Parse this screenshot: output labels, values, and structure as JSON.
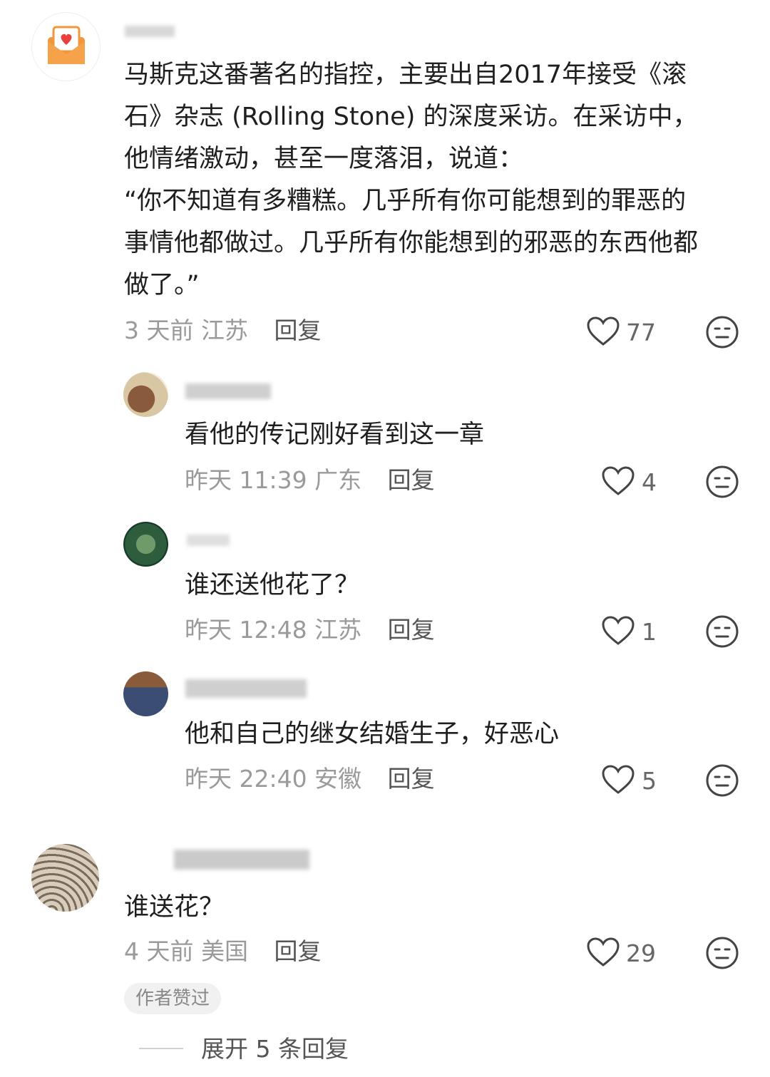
{
  "comments": [
    {
      "text_lines": [
        "马斯克这番著名的指控，主要出自2017年接受《滚",
        "石》杂志 (Rolling Stone) 的深度采访。在采访中，",
        "他情绪激动，甚至一度落泪，说道：",
        "“你不知道有多糟糕。几乎所有你可能想到的罪恶的",
        "事情他都做过。几乎所有你能想到的邪恶的东西他都",
        "做了。”"
      ],
      "meta": "3 天前 江苏",
      "reply_label": "回复",
      "likes": "77"
    },
    {
      "text_lines": [
        "谁送花？"
      ],
      "meta": "4 天前 美国",
      "reply_label": "回复",
      "likes": "29",
      "badge": "作者赞过"
    }
  ],
  "replies": [
    {
      "text": "看他的传记刚好看到这一章",
      "meta": "昨天 11:39 广东",
      "reply_label": "回复",
      "likes": "4"
    },
    {
      "text": "谁还送他花了？",
      "meta": "昨天 12:48 江苏",
      "reply_label": "回复",
      "likes": "1"
    },
    {
      "text": "他和自己的继女结婚生子，好恶心",
      "meta": "昨天 22:40 安徽",
      "reply_label": "回复",
      "likes": "5"
    }
  ],
  "expand_label": "展开 5 条回复",
  "icons": {
    "like": "heart-outline-icon",
    "dislike": "neutral-face-icon"
  },
  "colors": {
    "avatar_envelope": "#f0973b",
    "avatar_heart": "#e8413d"
  }
}
